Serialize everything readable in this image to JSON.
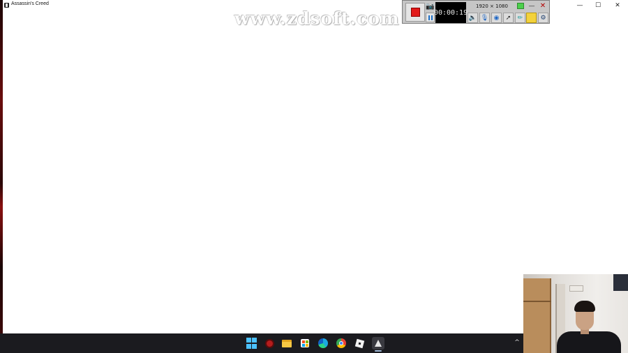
{
  "window": {
    "title": "Assassin's Creed",
    "controls": {
      "minimize": "—",
      "maximize": "☐",
      "close": "✕"
    }
  },
  "watermark": "www.zdsoft.com",
  "recorder": {
    "timer": "00:00:19",
    "resolution": "1920 × 1080",
    "icons": [
      "stop-icon",
      "camera-icon",
      "pause-icon",
      "speaker-icon",
      "microphone-icon",
      "webcam-icon",
      "cursor-icon",
      "pen-icon",
      "folder-icon",
      "gear-icon"
    ],
    "stop_color": "#e21b1b"
  },
  "taskbar": {
    "apps": [
      "start-icon",
      "screen-recorder-icon",
      "file-explorer-icon",
      "microsoft-store-icon",
      "edge-icon",
      "chrome-icon",
      "roblox-icon",
      "assassins-creed-icon"
    ],
    "accent": "#4cc2ff",
    "tray_chevron": "^"
  }
}
